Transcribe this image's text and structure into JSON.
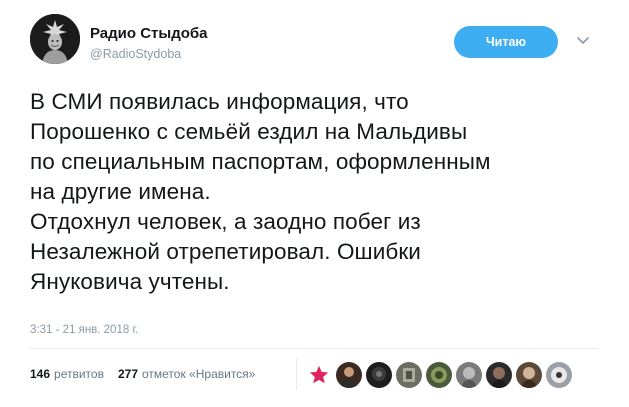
{
  "author": {
    "display_name": "Радио Стыдоба",
    "handle": "@RadioStydoba"
  },
  "follow_button": {
    "label": "Читаю"
  },
  "tweet": {
    "lines": [
      "В СМИ появилась информация, что",
      "Порошенко с семьёй ездил на Мальдивы",
      "по специальным паспортам, оформленным",
      "на другие имена.",
      "Отдохнул человек, а заодно побег из",
      "Незалежной отрепетировал. Ошибки",
      "Януковича учтены."
    ],
    "timestamp": "3:31 - 21 янв. 2018 г."
  },
  "stats": {
    "retweets_count": "146",
    "retweets_label": "ретвитов",
    "likes_count": "277",
    "likes_label": "отметок «Нравится»"
  },
  "likers": [
    {
      "name": "star-avatar-icon",
      "color": "#e0245e"
    },
    {
      "name": "liker-avatar-1",
      "color": "#3a2a22"
    },
    {
      "name": "liker-avatar-2",
      "color": "#1e1e1e"
    },
    {
      "name": "liker-avatar-3",
      "color": "#6b6e62"
    },
    {
      "name": "liker-avatar-4",
      "color": "#4a5a3a"
    },
    {
      "name": "liker-avatar-5",
      "color": "#7a7a7a"
    },
    {
      "name": "liker-avatar-6",
      "color": "#2b2b2b"
    },
    {
      "name": "liker-avatar-7",
      "color": "#5b4a3a"
    },
    {
      "name": "liker-avatar-8",
      "color": "#9aa0a6"
    }
  ]
}
